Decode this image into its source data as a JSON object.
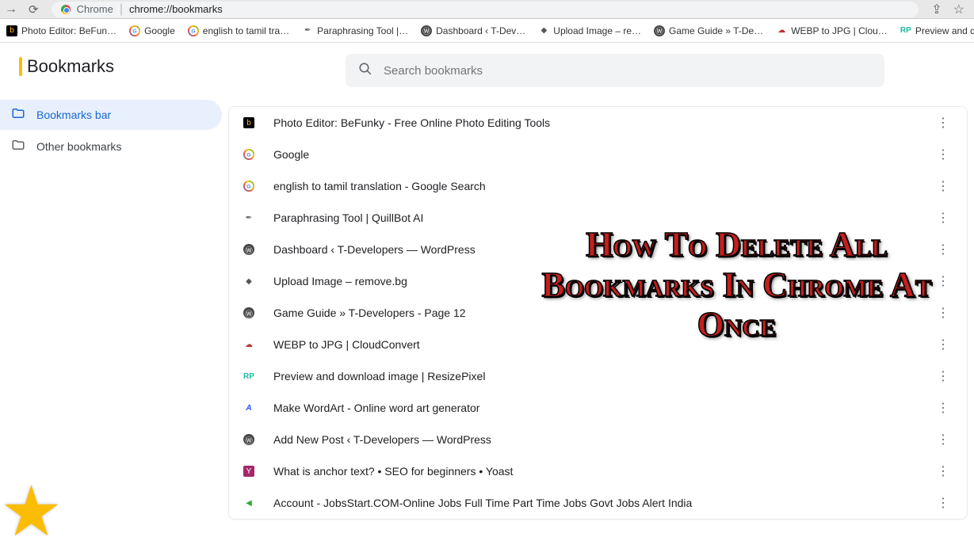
{
  "browser": {
    "url_label": "Chrome",
    "url_path": "chrome://bookmarks"
  },
  "bookmarks_bar": [
    {
      "label": "Photo Editor: BeFun…",
      "icon": "befunky"
    },
    {
      "label": "Google",
      "icon": "google"
    },
    {
      "label": "english to tamil tra…",
      "icon": "google"
    },
    {
      "label": "Paraphrasing Tool |…",
      "icon": "quill"
    },
    {
      "label": "Dashboard ‹ T-Dev…",
      "icon": "wp"
    },
    {
      "label": "Upload Image – re…",
      "icon": "removebg"
    },
    {
      "label": "Game Guide » T-De…",
      "icon": "wp"
    },
    {
      "label": "WEBP to JPG | Clou…",
      "icon": "cloud"
    },
    {
      "label": "Preview and downl…",
      "icon": "rp"
    }
  ],
  "page_title": "Bookmarks",
  "search": {
    "placeholder": "Search bookmarks"
  },
  "sidebar": {
    "bookmarks_bar": "Bookmarks bar",
    "other": "Other bookmarks"
  },
  "overlay_text": "How To Delete All Bookmarks In Chrome At Once",
  "bookmarks": [
    {
      "title": "Photo Editor: BeFunky - Free Online Photo Editing Tools",
      "icon": "befunky"
    },
    {
      "title": "Google",
      "icon": "google"
    },
    {
      "title": "english to tamil translation - Google Search",
      "icon": "google"
    },
    {
      "title": "Paraphrasing Tool | QuillBot AI",
      "icon": "quill"
    },
    {
      "title": "Dashboard ‹ T-Developers — WordPress",
      "icon": "wp"
    },
    {
      "title": "Upload Image – remove.bg",
      "icon": "removebg"
    },
    {
      "title": "Game Guide » T-Developers - Page 12",
      "icon": "wp"
    },
    {
      "title": "WEBP to JPG | CloudConvert",
      "icon": "cloud"
    },
    {
      "title": "Preview and download image | ResizePixel",
      "icon": "rp"
    },
    {
      "title": "Make WordArt - Online word art generator",
      "icon": "wordart"
    },
    {
      "title": "Add New Post ‹ T-Developers — WordPress",
      "icon": "wp"
    },
    {
      "title": "What is anchor text? • SEO for beginners • Yoast",
      "icon": "yoast"
    },
    {
      "title": "Account - JobsStart.COM-Online Jobs Full Time Part Time Jobs Govt Jobs Alert India",
      "icon": "jobs"
    }
  ]
}
